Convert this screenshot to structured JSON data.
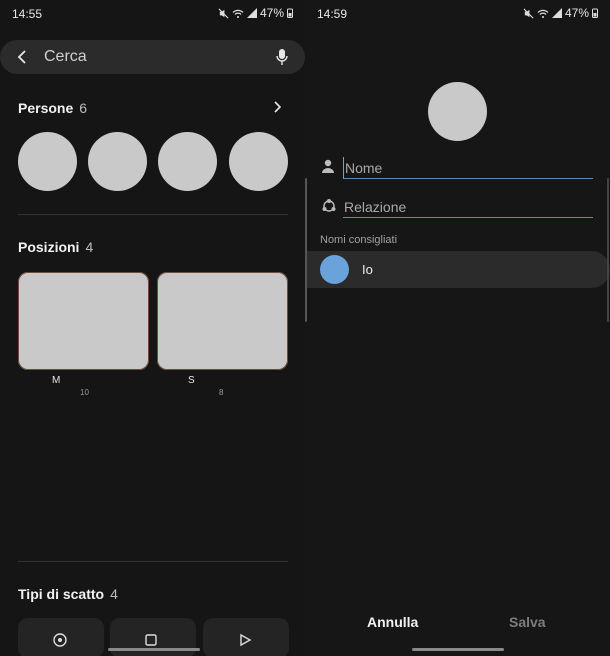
{
  "left": {
    "status": {
      "time": "14:55",
      "battery": "47%"
    },
    "search": {
      "placeholder": "Cerca"
    },
    "people": {
      "title": "Persone",
      "count": "6"
    },
    "places": {
      "title": "Posizioni",
      "count": "4",
      "items": [
        {
          "label": "M",
          "count": "10"
        },
        {
          "label": "S",
          "count": "8"
        }
      ]
    },
    "shots": {
      "title": "Tipi di scatto",
      "count": "4"
    }
  },
  "right": {
    "status": {
      "time": "14:59",
      "battery": "47%"
    },
    "name_field": {
      "placeholder": "Nome"
    },
    "relation_field": {
      "placeholder": "Relazione"
    },
    "suggest_label": "Nomi consigliati",
    "suggest_item": "Io",
    "cancel_label": "Annulla",
    "save_label": "Salva"
  },
  "colors": {
    "accent": "#6aa3dc",
    "save_disabled": "#7d7d7d",
    "underline": "#5f88b0"
  },
  "icons": [
    "back-arrow-icon",
    "mic-icon",
    "chevron-right-icon",
    "person-icon",
    "relation-icon",
    "mute-icon",
    "wifi-icon",
    "signal-icon",
    "battery-icon"
  ]
}
